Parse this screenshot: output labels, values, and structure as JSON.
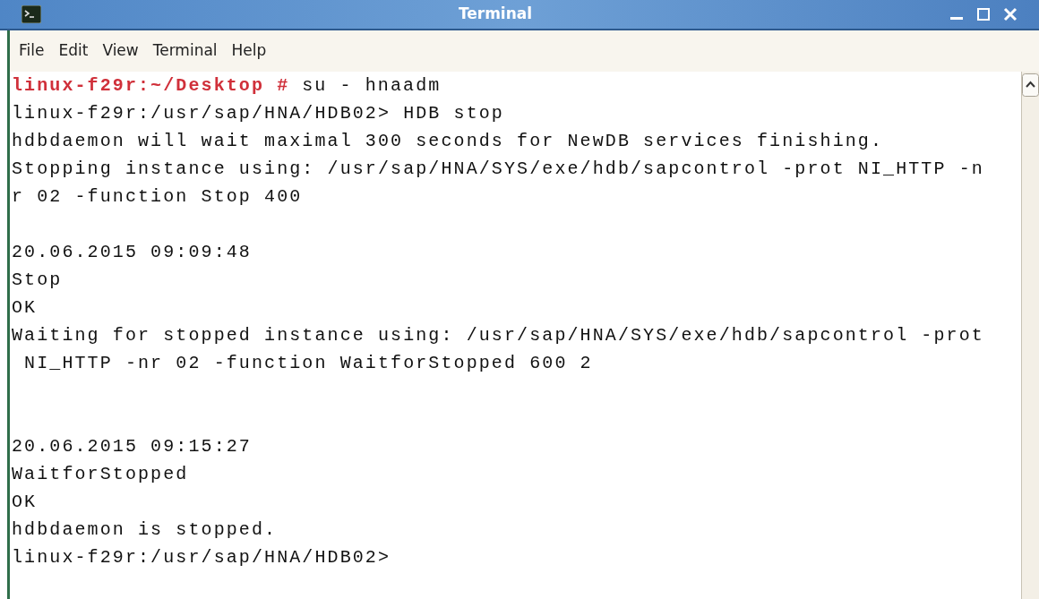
{
  "window": {
    "title": "Terminal"
  },
  "menu": [
    "File",
    "Edit",
    "View",
    "Terminal",
    "Help"
  ],
  "lines": [
    {
      "kind": "prompt",
      "prompt": "linux-f29r:~/Desktop #",
      "text": "su - hnaadm"
    },
    {
      "kind": "output",
      "text": "linux-f29r:/usr/sap/HNA/HDB02> HDB stop"
    },
    {
      "kind": "output",
      "text": "hdbdaemon will wait maximal 300 seconds for NewDB services finishing."
    },
    {
      "kind": "output",
      "text": "Stopping instance using: /usr/sap/HNA/SYS/exe/hdb/sapcontrol -prot NI_HTTP -n"
    },
    {
      "kind": "output",
      "text": "r 02 -function Stop 400"
    },
    {
      "kind": "blank"
    },
    {
      "kind": "output",
      "text": "20.06.2015 09:09:48"
    },
    {
      "kind": "output",
      "text": "Stop"
    },
    {
      "kind": "output",
      "text": "OK"
    },
    {
      "kind": "output",
      "text": "Waiting for stopped instance using: /usr/sap/HNA/SYS/exe/hdb/sapcontrol -prot"
    },
    {
      "kind": "output",
      "text": " NI_HTTP -nr 02 -function WaitforStopped 600 2"
    },
    {
      "kind": "blank"
    },
    {
      "kind": "blank"
    },
    {
      "kind": "output",
      "text": "20.06.2015 09:15:27"
    },
    {
      "kind": "output",
      "text": "WaitforStopped"
    },
    {
      "kind": "output",
      "text": "OK"
    },
    {
      "kind": "output",
      "text": "hdbdaemon is stopped."
    },
    {
      "kind": "output",
      "text": "linux-f29r:/usr/sap/HNA/HDB02>"
    }
  ]
}
